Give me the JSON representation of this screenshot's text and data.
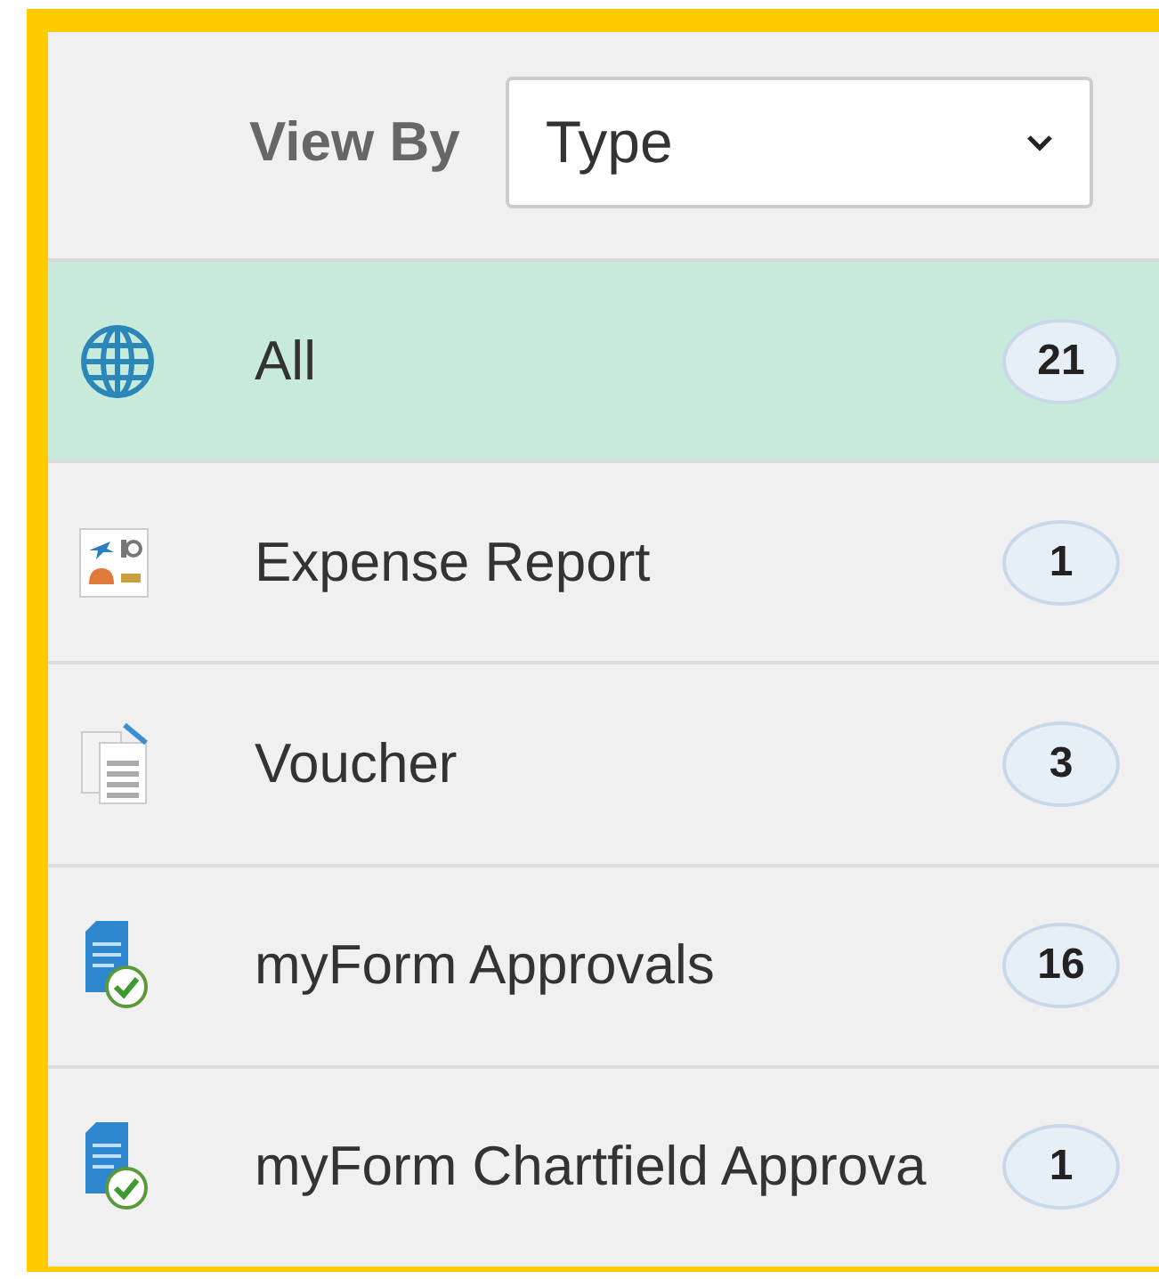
{
  "view_by": {
    "label": "View By",
    "value": "Type"
  },
  "items": [
    {
      "kind": "globe",
      "label": "All",
      "count": "21",
      "selected": true
    },
    {
      "kind": "expense",
      "label": "Expense Report",
      "count": "1",
      "selected": false
    },
    {
      "kind": "voucher",
      "label": "Voucher",
      "count": "3",
      "selected": false
    },
    {
      "kind": "form",
      "label": "myForm Approvals",
      "count": "16",
      "selected": false
    },
    {
      "kind": "form",
      "label": "myForm Chartfield Approva",
      "count": "1",
      "selected": false
    }
  ]
}
